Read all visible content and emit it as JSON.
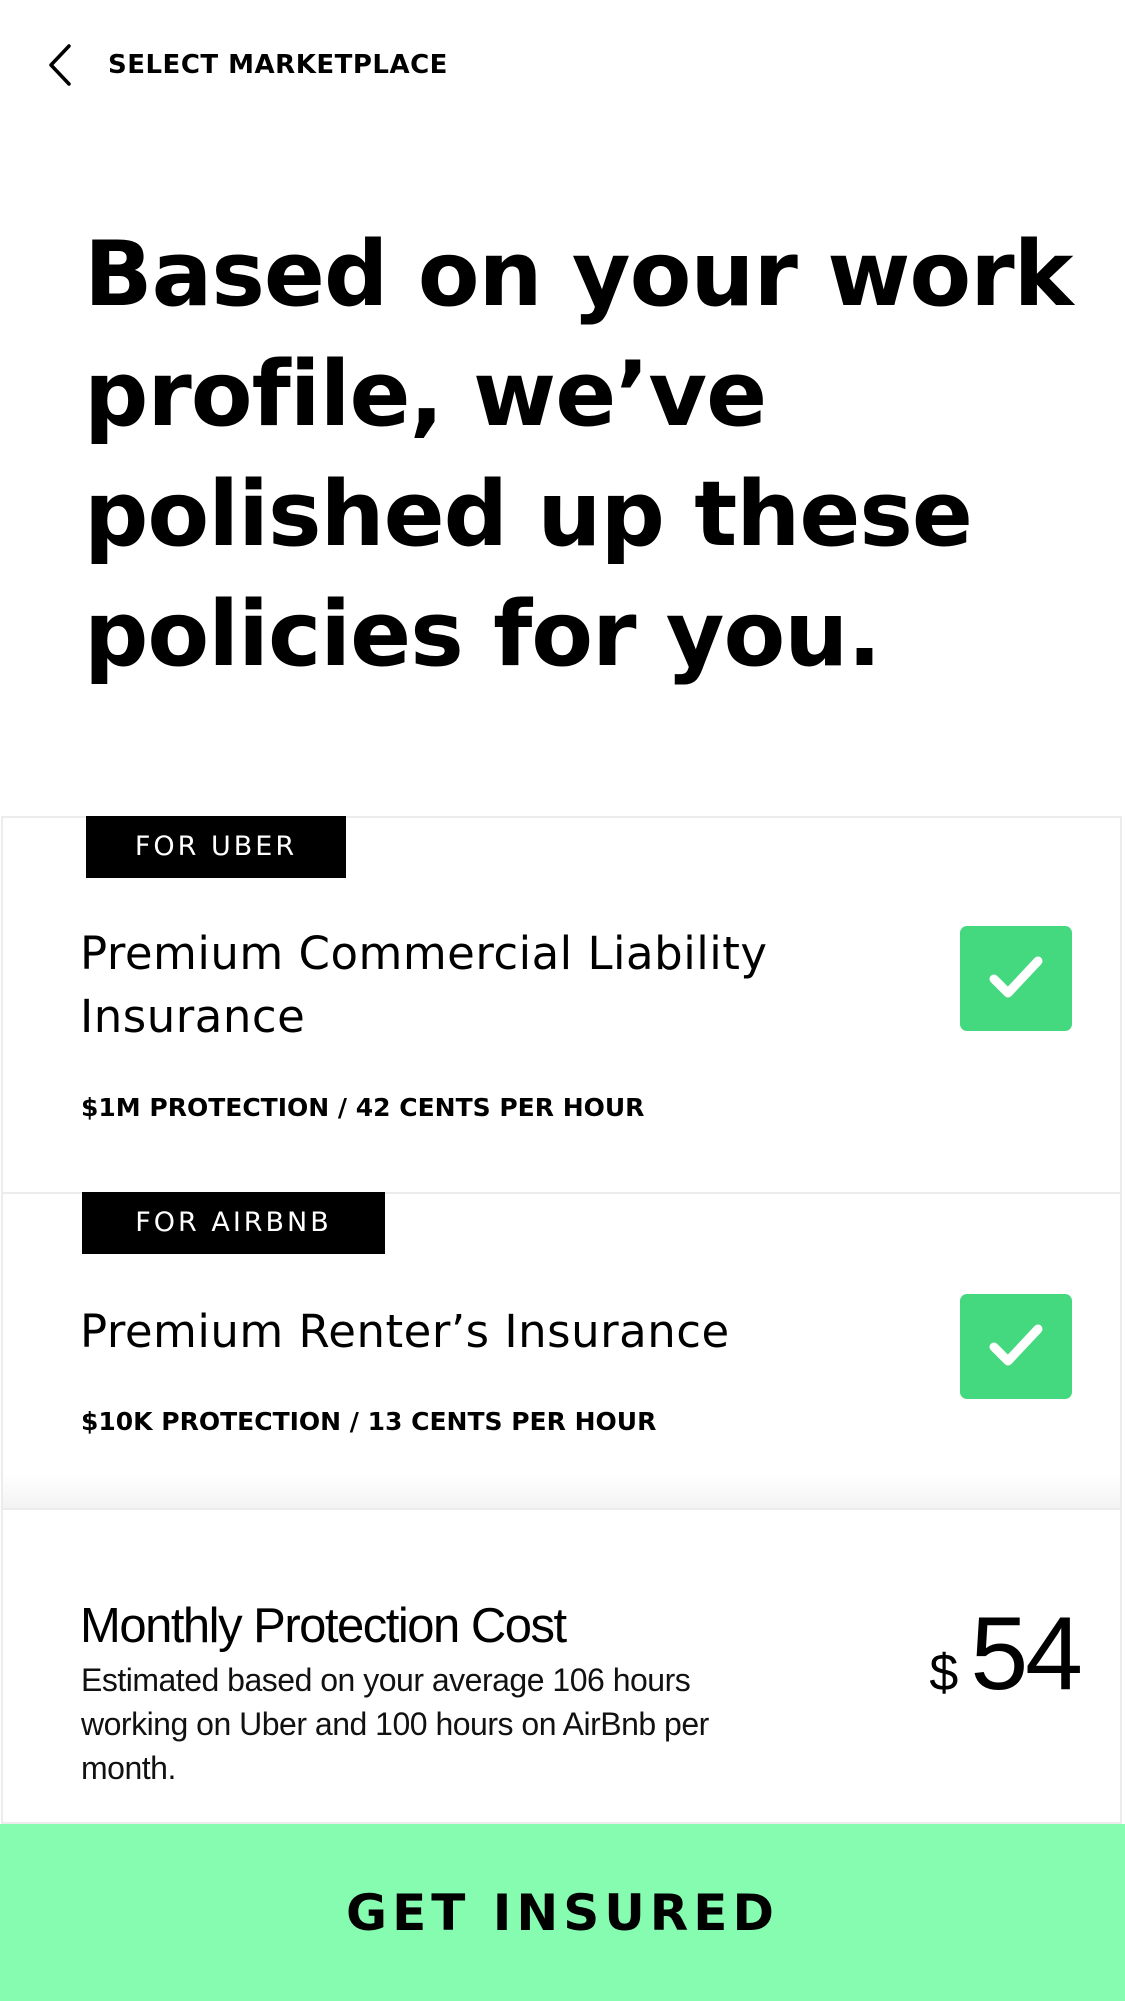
{
  "nav": {
    "back_icon": "chevron-left-icon",
    "title": "SELECT MARKETPLACE"
  },
  "headline": "Based on your work profile, we’ve polished up these policies for you.",
  "policies": [
    {
      "tag": "FOR UBER",
      "title": "Premium Commercial Liability Insurance",
      "detail": "$1M PROTECTION / 42 CENTS PER HOUR",
      "selected": true,
      "check_icon": "checkmark-icon"
    },
    {
      "tag": "FOR AIRBNB",
      "title": "Premium Renter’s Insurance",
      "detail": "$10K PROTECTION / 13 CENTS PER HOUR",
      "selected": true,
      "check_icon": "checkmark-icon"
    }
  ],
  "cost": {
    "title": "Monthly Protection Cost",
    "description": "Estimated based on your average 106 hours working on Uber and 100 hours on AirBnb per month.",
    "currency": "$",
    "amount": "54"
  },
  "cta": {
    "label": "GET INSURED"
  },
  "colors": {
    "check_green": "#44d87f",
    "cta_green": "#86fcb1",
    "tag_background": "#000000",
    "text": "#000000",
    "divider": "#ececec"
  }
}
